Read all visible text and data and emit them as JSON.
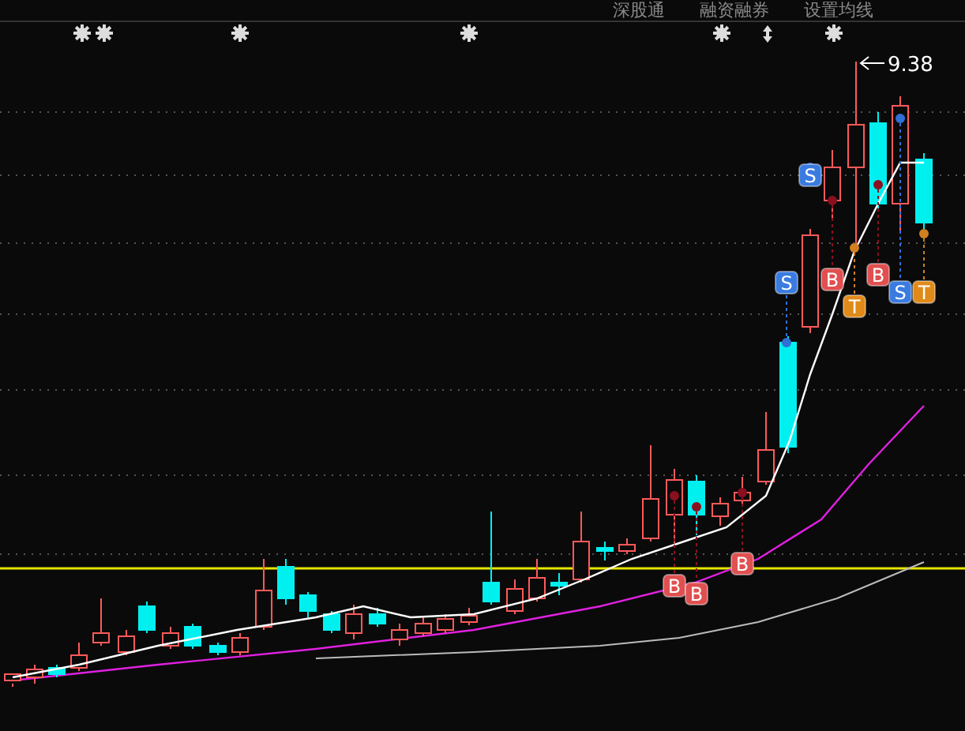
{
  "header": {
    "links": [
      "深股通",
      "融资融券",
      "设置均线"
    ]
  },
  "chart": {
    "price_label": "9.38",
    "signals": [
      {
        "kind": "sell",
        "label": "S"
      },
      {
        "kind": "sell",
        "label": "S"
      },
      {
        "kind": "buy",
        "label": "B"
      },
      {
        "kind": "t",
        "label": "T"
      },
      {
        "kind": "buy",
        "label": "B"
      },
      {
        "kind": "sell",
        "label": "S"
      },
      {
        "kind": "t",
        "label": "T"
      },
      {
        "kind": "buy",
        "label": "B"
      },
      {
        "kind": "buy",
        "label": "B"
      },
      {
        "kind": "buy",
        "label": "B"
      }
    ]
  }
}
